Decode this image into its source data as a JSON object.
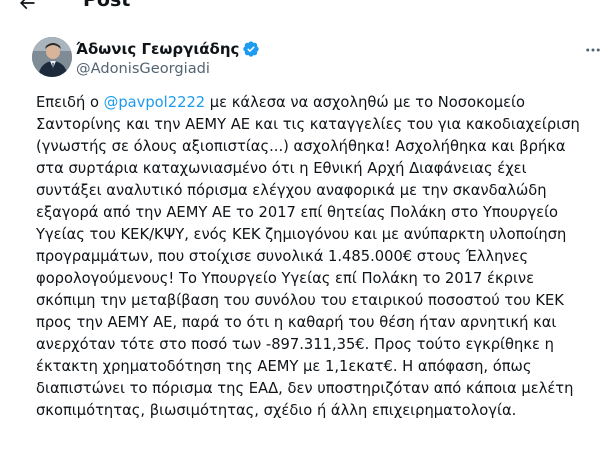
{
  "header": {
    "title": "Post",
    "back_icon": "arrow-left-icon"
  },
  "author": {
    "display_name": "Άδωνις Γεωργιάδης",
    "handle": "@AdonisGeorgiadi",
    "verified_icon": "verified-badge-icon",
    "verified_color": "#1d9bf0",
    "more_icon": "more-horizontal-icon"
  },
  "tweet": {
    "line_1_before": "Επειδή ο ",
    "mention": "@pavpol2222",
    "line_1_after": " με κάλεσα να ασχοληθώ με το Νοσοκομείο",
    "lines": [
      "Σαντορίνης και την ΑΕΜΥ ΑΕ και τις καταγγελίες του για κακοδιαχείριση",
      "(γνωστής σε όλους αξιοπιστίας...) ασχολήθηκα! Ασχολήθηκα και βρήκα",
      "στα συρτάρια καταχωνιασμένο ότι η Εθνική Αρχή Διαφάνειας έχει",
      "συντάξει αναλυτικό πόρισμα ελέγχου αναφορικά με την σκανδαλώδη",
      "εξαγορά από την ΑΕΜΥ ΑΕ το 2017 επί θητείας Πολάκη στο Υπουργείο",
      "Υγείας του ΚΕΚ/ΚΨΥ, ενός ΚΕΚ ζημιογόνου και με ανύπαρκτη υλοποίηση",
      "προγραμμάτων, που στοίχισε συνολικά 1.485.000€ στους Έλληνες",
      "φορολογούμενους! Το Υπουργείο Υγείας επί Πολάκη το 2017 έκρινε",
      "σκόπιμη την μεταβίβαση του συνόλου του εταιρικού ποσοστού του ΚΕΚ",
      "προς την ΑΕΜΥ ΑΕ, παρά το ότι η καθαρή του θέση ήταν αρνητική και",
      "ανερχόταν τότε στο ποσό των -897.311,35€. Προς τούτο εγκρίθηκε η",
      "έκτακτη χρηματοδότηση της ΑΕΜΥ με 1,1εκατ€. Η απόφαση, όπως",
      "διαπιστώνει το πόρισμα της ΕΑΔ, δεν υποστηριζόταν από κάποια μελέτη",
      "σκοπιμότητας, βιωσιμότητας, σχέδιο ή άλλη επιχειρηματολογία."
    ]
  }
}
